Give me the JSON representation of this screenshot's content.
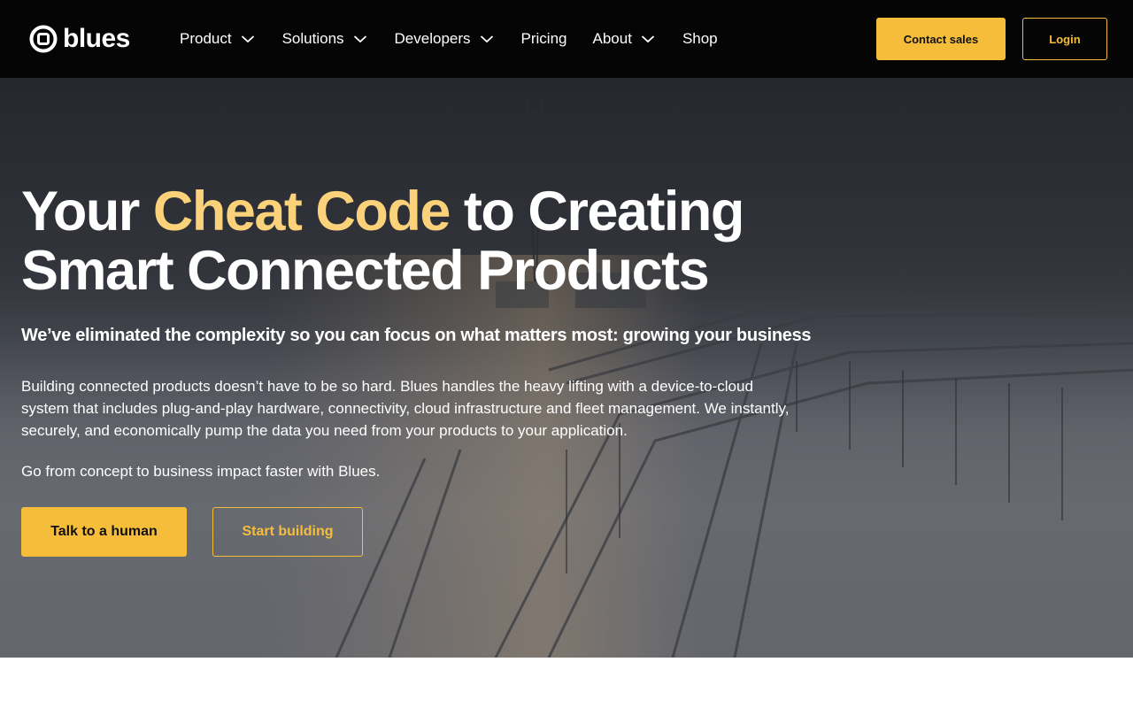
{
  "header": {
    "logo_text": "blues",
    "logo_icon": "blues-logo-icon",
    "nav": [
      {
        "label": "Product",
        "has_dropdown": true
      },
      {
        "label": "Solutions",
        "has_dropdown": true
      },
      {
        "label": "Developers",
        "has_dropdown": true
      },
      {
        "label": "Pricing",
        "has_dropdown": false
      },
      {
        "label": "About",
        "has_dropdown": true
      },
      {
        "label": "Shop",
        "has_dropdown": false
      }
    ],
    "contact_label": "Contact sales",
    "login_label": "Login"
  },
  "hero": {
    "title_before": "Your ",
    "title_accent": "Cheat Code",
    "title_after_line1": " to Creating",
    "title_line2": "Smart Connected Products",
    "subtitle": "We’ve eliminated the complexity so you can focus on what matters most: growing your business",
    "body": "Building connected products doesn’t have to be so hard. Blues handles the heavy lifting with a device-to-cloud system that includes plug-and-play hardware, connectivity, cloud infrastructure and fleet management. We instantly, securely, and economically pump the data you need from your products to your application.",
    "body2": "Go from concept to business impact faster with Blues.",
    "primary_cta": "Talk to a human",
    "secondary_cta": "Start building",
    "background": "industrial-site-snow-photo"
  },
  "colors": {
    "accent": "#f5bd3a",
    "accent_text": "#fbd27a",
    "nav_bg": "#050505"
  }
}
